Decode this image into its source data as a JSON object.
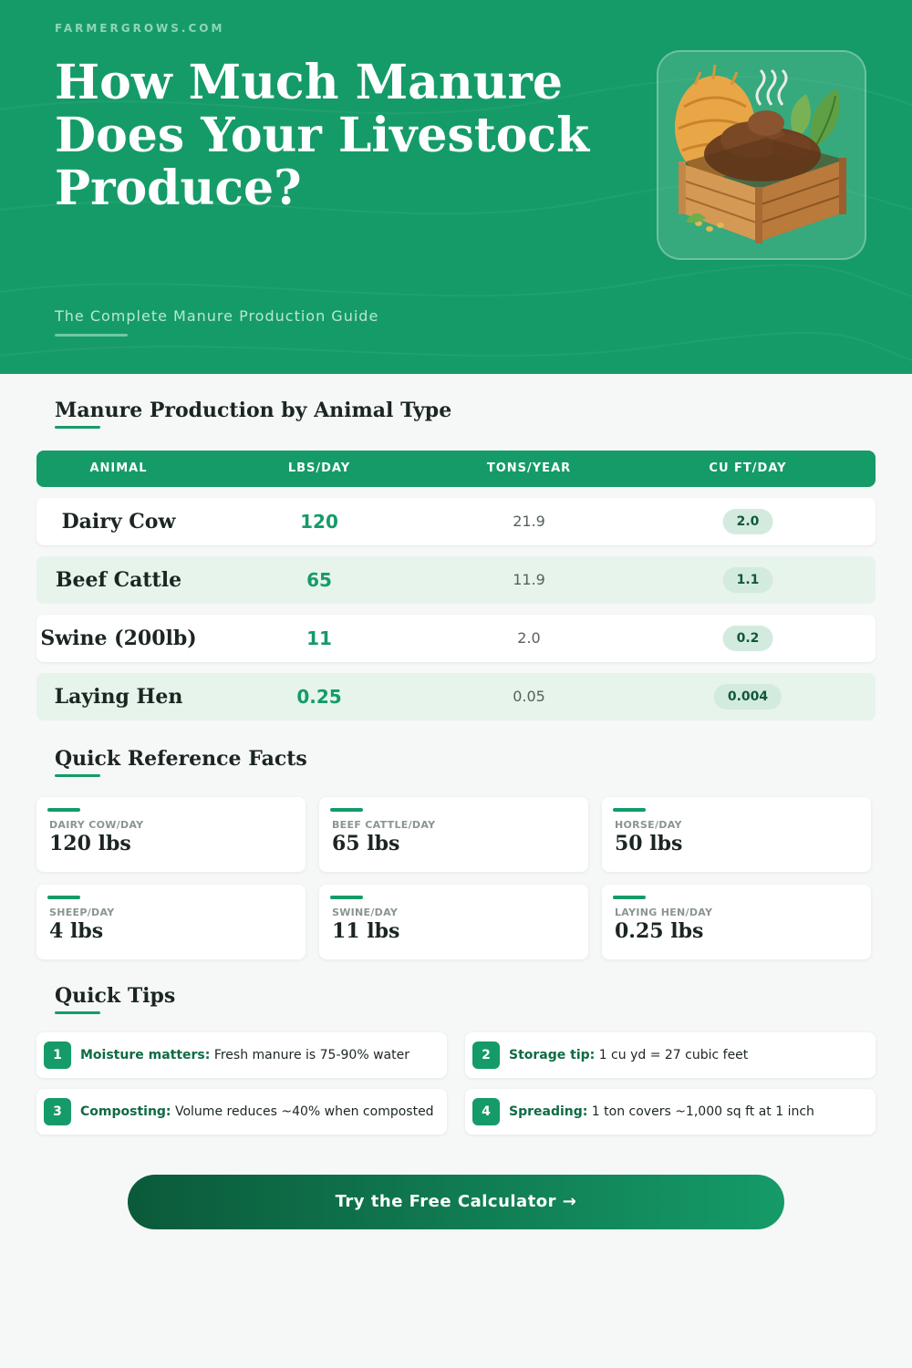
{
  "header": {
    "brand": "FARMERGROWS.COM",
    "title": "How Much Manure Does Your Livestock Produce?",
    "subtitle": "The Complete Manure Production Guide",
    "illustration": "manure-compost-bin-illustration"
  },
  "production": {
    "heading": "Manure Production by Animal Type",
    "columns": [
      "ANIMAL",
      "LBS/DAY",
      "TONS/YEAR",
      "CU FT/DAY"
    ],
    "rows": [
      {
        "animal": "Dairy Cow",
        "lbs_day": "120",
        "tons_year": "21.9",
        "cuft_day": "2.0"
      },
      {
        "animal": "Beef Cattle",
        "lbs_day": "65",
        "tons_year": "11.9",
        "cuft_day": "1.1"
      },
      {
        "animal": "Swine (200lb)",
        "lbs_day": "11",
        "tons_year": "2.0",
        "cuft_day": "0.2"
      },
      {
        "animal": "Laying Hen",
        "lbs_day": "0.25",
        "tons_year": "0.05",
        "cuft_day": "0.004"
      }
    ]
  },
  "facts": {
    "heading": "Quick Reference Facts",
    "items": [
      {
        "label": "DAIRY COW/DAY",
        "value": "120 lbs"
      },
      {
        "label": "BEEF CATTLE/DAY",
        "value": "65 lbs"
      },
      {
        "label": "HORSE/DAY",
        "value": "50 lbs"
      },
      {
        "label": "SHEEP/DAY",
        "value": "4 lbs"
      },
      {
        "label": "SWINE/DAY",
        "value": "11 lbs"
      },
      {
        "label": "LAYING HEN/DAY",
        "value": "0.25 lbs"
      }
    ]
  },
  "tips": {
    "heading": "Quick Tips",
    "items": [
      {
        "num": "1",
        "title": "Moisture matters:",
        "text": " Fresh manure is 75-90% water"
      },
      {
        "num": "2",
        "title": "Storage tip:",
        "text": " 1 cu yd = 27 cubic feet"
      },
      {
        "num": "3",
        "title": "Composting:",
        "text": " Volume reduces ~40% when composted"
      },
      {
        "num": "4",
        "title": "Spreading:",
        "text": " 1 ton covers ~1,000 sq ft at 1 inch"
      }
    ]
  },
  "cta": {
    "label": "Try the Free Calculator →"
  },
  "colors": {
    "primary": "#159b68",
    "dark": "#0b5a3a",
    "row_alt": "#e6f4ec",
    "pill": "#d3ebde"
  }
}
